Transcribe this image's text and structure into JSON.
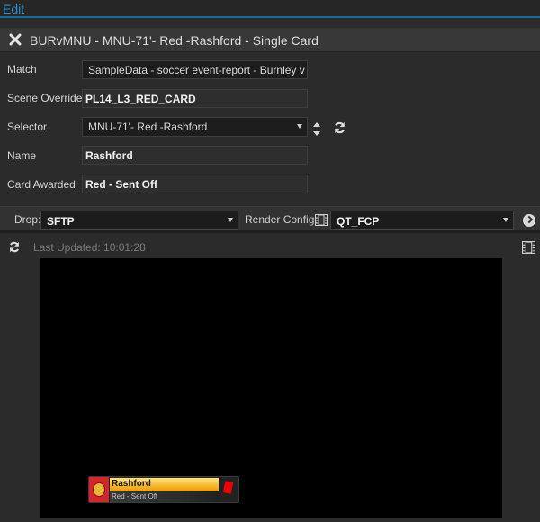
{
  "topbar": {
    "edit_label": "Edit"
  },
  "titlebar": {
    "title": "BURvMNU - MNU-71'- Red -Rashford - Single Card",
    "close_icon": "close-icon"
  },
  "form": {
    "match": {
      "label": "Match",
      "value": "SampleData - soccer event-report - Burnley v ..."
    },
    "scene_override": {
      "label": "Scene Override",
      "value": "PL14_L3_RED_CARD"
    },
    "selector": {
      "label": "Selector",
      "value": "MNU-71'- Red -Rashford"
    },
    "name": {
      "label": "Name",
      "value": "Rashford"
    },
    "card_awarded": {
      "label": "Card Awarded",
      "value": "Red - Sent Off"
    }
  },
  "dropbar": {
    "drop_label": "Drop:",
    "drop_value": "SFTP",
    "render_label": "Render Config:",
    "render_value": "QT_FCP"
  },
  "preview": {
    "last_updated": "Last Updated: 10:01:28",
    "lower_third": {
      "player_name": "Rashford",
      "card_text": "Red - Sent Off",
      "card_color": "#e00000",
      "bar_color": "#f6b62a"
    }
  }
}
